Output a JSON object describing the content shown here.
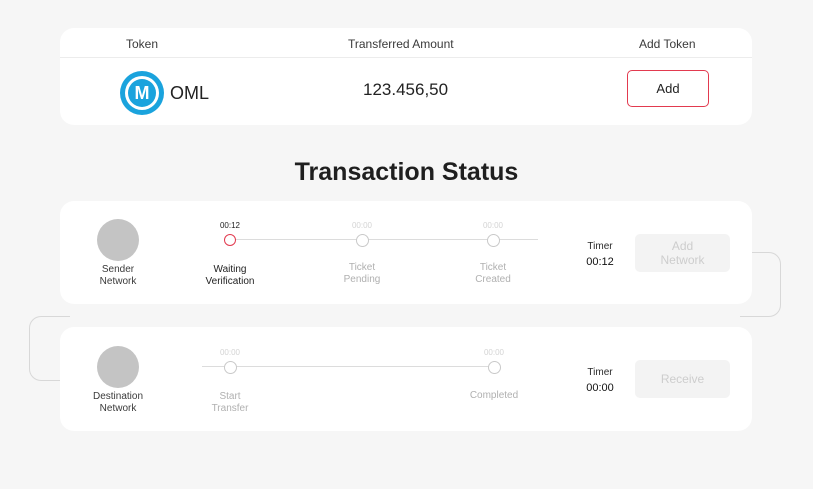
{
  "token_table": {
    "headers": {
      "token": "Token",
      "amount": "Transferred Amount",
      "add_token": "Add Token"
    },
    "row": {
      "token_symbol": "OML",
      "token_logo_letter": "M",
      "amount": "123.456,50",
      "add_label": "Add"
    }
  },
  "title": "Transaction Status",
  "sender": {
    "network_label_1": "Sender",
    "network_label_2": "Network",
    "steps": [
      {
        "time": "00:12",
        "label_1": "Waiting",
        "label_2": "Verification",
        "active": true
      },
      {
        "time": "00:00",
        "label_1": "Ticket",
        "label_2": "Pending",
        "active": false
      },
      {
        "time": "00:00",
        "label_1": "Ticket",
        "label_2": "Created",
        "active": false
      }
    ],
    "timer_label": "Timer",
    "timer_value": "00:12",
    "button_label_1": "Add",
    "button_label_2": "Network"
  },
  "destination": {
    "network_label_1": "Destination",
    "network_label_2": "Network",
    "steps": [
      {
        "time": "00:00",
        "label_1": "Start",
        "label_2": "Transfer",
        "active": false
      },
      {
        "time": "00:00",
        "label_1": "Completed",
        "label_2": "",
        "active": false
      }
    ],
    "timer_label": "Timer",
    "timer_value": "00:00",
    "button_label": "Receive"
  },
  "colors": {
    "accent": "#e23a4f",
    "brand": "#1aa3dd",
    "background": "#f6f6f6"
  },
  "icons": {
    "token_logo": "oml-logo-icon"
  }
}
